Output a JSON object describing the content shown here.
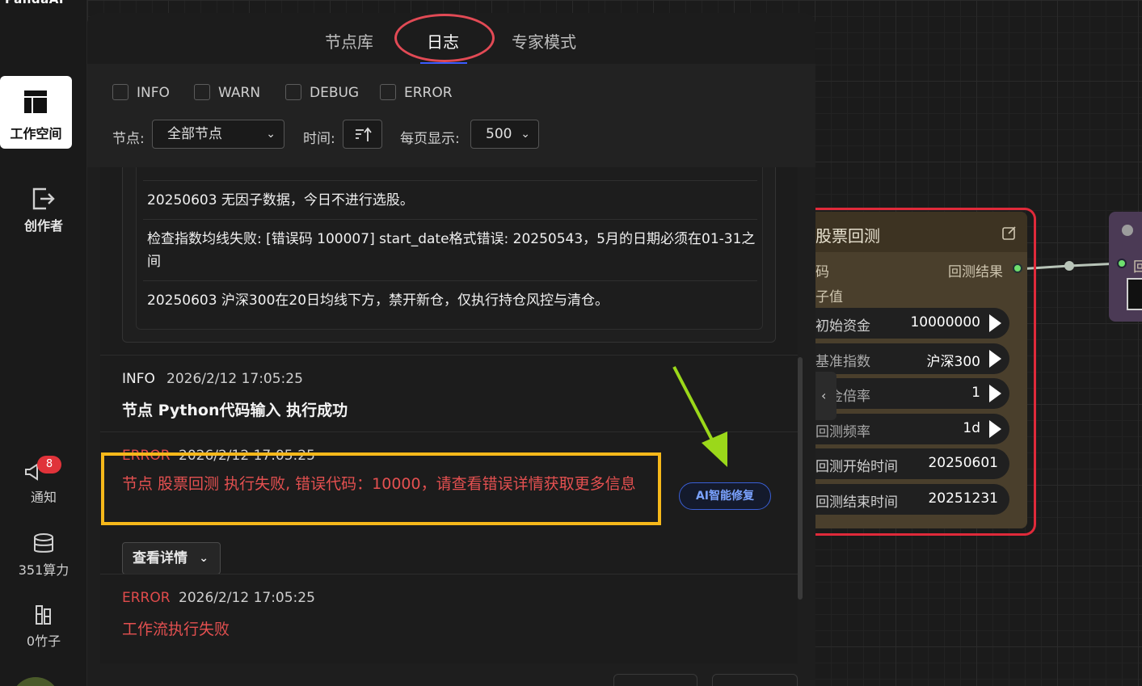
{
  "brand": "PandaAI",
  "sidebar": {
    "items": [
      {
        "label": "工作空间",
        "icon": "layout-icon",
        "active": true
      },
      {
        "label": "创作者",
        "icon": "exit-icon"
      },
      {
        "label": "通知",
        "icon": "megaphone-icon",
        "badge": "8"
      },
      {
        "label": "351算力",
        "icon": "database-icon"
      },
      {
        "label": "0竹子",
        "icon": "bamboo-icon"
      }
    ]
  },
  "tabs": [
    {
      "label": "节点库"
    },
    {
      "label": "日志",
      "active": true
    },
    {
      "label": "专家模式"
    }
  ],
  "filters": {
    "levels": [
      "INFO",
      "WARN",
      "DEBUG",
      "ERROR"
    ],
    "node_label": "节点:",
    "node_value": "全部节点",
    "time_label": "时间:",
    "page_size_label": "每页显示:",
    "page_size_value": "500"
  },
  "nested_log": [
    "20250603 无因子数据，今日不进行选股。",
    "检查指数均线失败: [错误码 100007] start_date格式错误: 20250543，5月的日期必须在01-31之间",
    "20250603 沪深300在20日均线下方，禁开新仓，仅执行持仓风控与清仓。"
  ],
  "logs": [
    {
      "level": "INFO",
      "time": "2026/2/12 17:05:25",
      "message": "节点 Python代码输入 执行成功"
    },
    {
      "level": "ERROR",
      "time": "2026/2/12 17:05:25",
      "message": "节点 股票回测 执行失败, 错误代码：10000，请查看错误详情获取更多信息",
      "ai_fix_label": "AI智能修复",
      "detail_label": "查看详情"
    },
    {
      "level": "ERROR",
      "time": "2026/2/12 17:05:25",
      "message": "工作流执行失败"
    }
  ],
  "node": {
    "title": "股票回测",
    "input_1": "码",
    "input_2": "子值",
    "output": "回测结果",
    "params": [
      {
        "label": "初始资金",
        "value": "10000000",
        "arrow": true
      },
      {
        "label": "基准指数",
        "value": "沪深300",
        "arrow": true
      },
      {
        "label": "佣金倍率",
        "value": "1",
        "arrow": true
      },
      {
        "label": "回测频率",
        "value": "1d",
        "arrow": true
      },
      {
        "label": "回测开始时间",
        "value": "20250601",
        "arrow": false
      },
      {
        "label": "回测结束时间",
        "value": "20251231",
        "arrow": false
      }
    ]
  },
  "next_node_label": "回",
  "colors": {
    "error": "#e04b4b",
    "highlight": "#f6b81a",
    "accent": "#3a5bff",
    "node_outline": "#e02a3a"
  }
}
